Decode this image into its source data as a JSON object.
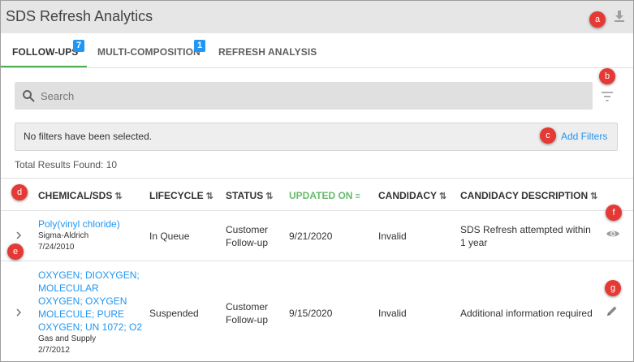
{
  "app": {
    "title": "SDS Refresh Analytics",
    "download_icon": "download-icon"
  },
  "tabs": [
    {
      "label": "FOLLOW-UPS",
      "badge": "7",
      "active": true
    },
    {
      "label": "MULTI-COMPOSITION",
      "badge": "1",
      "active": false
    },
    {
      "label": "REFRESH ANALYSIS",
      "badge": "",
      "active": false
    }
  ],
  "search": {
    "placeholder": "Search",
    "value": ""
  },
  "filters": {
    "status_text": "No filters have been selected.",
    "add_label": "Add Filters"
  },
  "results": {
    "total_text": "Total Results Found: 10"
  },
  "table": {
    "columns": [
      {
        "label": "CHEMICAL/SDS",
        "sort": "both"
      },
      {
        "label": "LIFECYCLE",
        "sort": "both"
      },
      {
        "label": "STATUS",
        "sort": "both"
      },
      {
        "label": "UPDATED ON",
        "sort": "active"
      },
      {
        "label": "CANDIDACY",
        "sort": "both"
      },
      {
        "label": "CANDIDACY DESCRIPTION",
        "sort": "both"
      }
    ],
    "rows": [
      {
        "chemical_lines": [
          "Poly(vinyl chloride)"
        ],
        "supplier": "Sigma-Aldrich",
        "sds_date": "7/24/2010",
        "lifecycle": "In Queue",
        "status_lines": [
          "Customer",
          "Follow-up"
        ],
        "updated_on": "9/21/2020",
        "candidacy": "Invalid",
        "description_lines": [
          "SDS Refresh attempted within",
          "1 year"
        ],
        "action_icon": "eye-icon"
      },
      {
        "chemical_lines": [
          "OXYGEN; DIOXYGEN;",
          "MOLECULAR",
          "OXYGEN; OXYGEN",
          "MOLECULE; PURE",
          "OXYGEN; UN 1072; O2"
        ],
        "supplier": "Gas and Supply",
        "sds_date": "2/7/2012",
        "lifecycle": "Suspended",
        "status_lines": [
          "Customer",
          "Follow-up"
        ],
        "updated_on": "9/15/2020",
        "candidacy": "Invalid",
        "description_lines": [
          "Additional information required"
        ],
        "action_icon": "edit-icon"
      }
    ]
  },
  "markers": [
    "a",
    "b",
    "c",
    "d",
    "e",
    "f",
    "g"
  ],
  "colors": {
    "accent_green": "#4caf50",
    "link_blue": "#2196f3",
    "badge_blue": "#2196f3",
    "marker_red": "#e53935"
  }
}
